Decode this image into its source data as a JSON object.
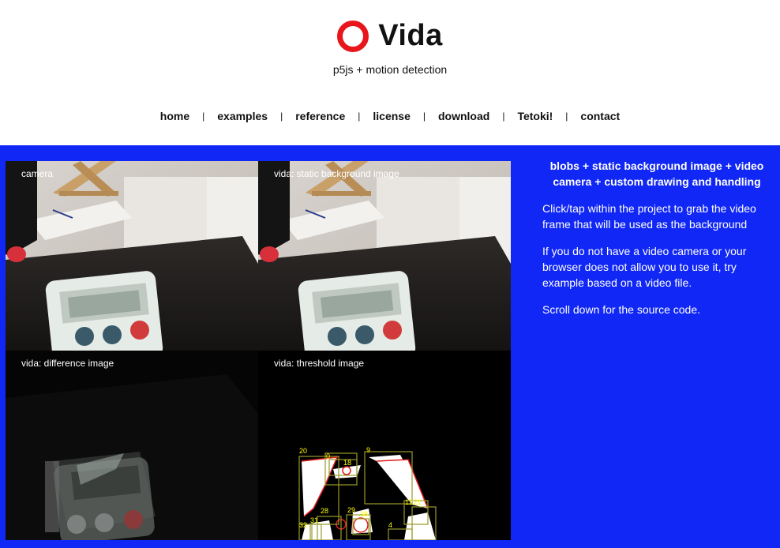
{
  "header": {
    "title": "Vida",
    "subtitle": "p5js + motion detection"
  },
  "nav": {
    "items": [
      "home",
      "examples",
      "reference",
      "license",
      "download",
      "Tetoki!",
      "contact"
    ],
    "separator": "|"
  },
  "canvas": {
    "labels": {
      "camera": "camera",
      "background": "vida: static background image",
      "difference": "vida: difference image",
      "threshold": "vida: threshold image"
    },
    "blob_labels": [
      "20",
      "9",
      "0",
      "18",
      "28",
      "29",
      "38",
      "12",
      "21",
      "32",
      "31",
      "4"
    ]
  },
  "sidebar": {
    "heading": "blobs + static background image + video camera + custom drawing and handling",
    "p1": "Click/tap within the project to grab the video frame that will be used as the background",
    "p2": "If you do not have a video camera or your browser does not allow you to use it, try example based on a video file.",
    "p3": "Scroll down for the source code."
  },
  "colors": {
    "background_blue": "#1027f5",
    "logo_red": "#e8151b",
    "blob_box": "#9a9a2a",
    "blob_label": "#ffff00"
  }
}
